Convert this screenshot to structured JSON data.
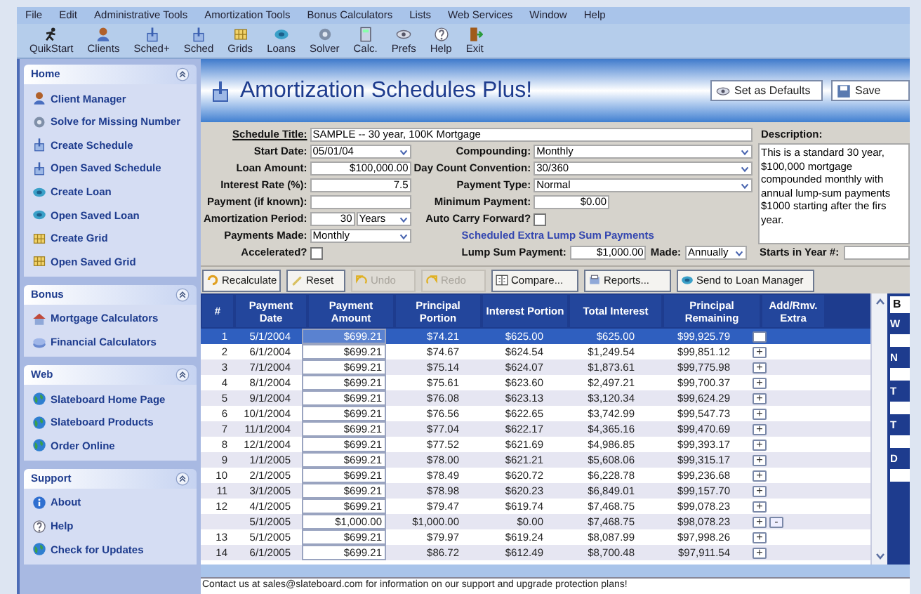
{
  "menu": [
    "File",
    "Edit",
    "Administrative Tools",
    "Amortization Tools",
    "Bonus Calculators",
    "Lists",
    "Web Services",
    "Window",
    "Help"
  ],
  "toolbar": [
    "QuikStart",
    "Clients",
    "Sched+",
    "Sched",
    "Grids",
    "Loans",
    "Solver",
    "Calc.",
    "Prefs",
    "Help",
    "Exit"
  ],
  "sidebar": [
    {
      "title": "Home",
      "items": [
        "Client Manager",
        "Solve for Missing Number",
        "Create Schedule",
        "Open Saved Schedule",
        "Create Loan",
        "Open Saved Loan",
        "Create Grid",
        "Open Saved Grid"
      ]
    },
    {
      "title": "Bonus",
      "items": [
        "Mortgage Calculators",
        "Financial Calculators"
      ]
    },
    {
      "title": "Web",
      "items": [
        "Slateboard Home Page",
        "Slateboard Products",
        "Order Online"
      ]
    },
    {
      "title": "Support",
      "items": [
        "About",
        "Help",
        "Check for Updates"
      ]
    }
  ],
  "header": {
    "title": "Amortization Schedules Plus!",
    "buttons": [
      "Set as Defaults",
      "Save"
    ]
  },
  "form": {
    "title_field": {
      "label": "Schedule Title:",
      "value": "SAMPLE -- 30 year, 100K Mortgage"
    },
    "left": [
      {
        "kind": "dropdown",
        "label": "Start Date:",
        "value": "05/01/04"
      },
      {
        "kind": "text",
        "label": "Loan Amount:",
        "value": "$100,000.00"
      },
      {
        "kind": "text",
        "label": "Interest Rate (%):",
        "value": "7.5"
      },
      {
        "kind": "text",
        "label": "Payment (if known):"
      },
      {
        "kind": "period",
        "label": "Amortization Period:",
        "value": "30",
        "unit": "Years"
      },
      {
        "kind": "dropdown",
        "label": "Payments Made:",
        "value": "Monthly"
      }
    ],
    "middle": [
      {
        "kind": "dropdown",
        "label": "Compounding:",
        "value": "Monthly"
      },
      {
        "kind": "dropdown",
        "label": "Day Count Convention:",
        "value": "30/360"
      },
      {
        "kind": "dropdown",
        "label": "Payment Type:",
        "value": "Normal"
      },
      {
        "kind": "text",
        "label": "Minimum Payment:",
        "value": "$0.00"
      },
      {
        "kind": "checkbox",
        "label": "Auto Carry Forward?",
        "checked": false
      },
      {
        "kind": "heading",
        "label": "Scheduled Extra Lump Sum Payments"
      }
    ],
    "description": {
      "label": "Description:",
      "text": "This is a standard 30 year,\n$100,000 mortgage\ncompounded monthly with\nannual lump-sum payments\n$1000 starting after the firs\nyear."
    },
    "accelerated": {
      "label": "Accelerated?",
      "checked": false
    },
    "lump": {
      "label": "Lump Sum Payment:",
      "value": "$1,000.00",
      "made_label": "Made:",
      "made_value": "Annually",
      "start_label": "Starts in Year #:"
    }
  },
  "action_buttons": [
    {
      "label": "Recalculate",
      "disabled": false
    },
    {
      "label": "Reset",
      "disabled": false
    },
    {
      "label": "Undo",
      "disabled": true
    },
    {
      "label": "Redo",
      "disabled": true
    },
    {
      "label": "Compare...",
      "disabled": false
    },
    {
      "label": "Reports...",
      "disabled": false
    },
    {
      "label": "Send to Loan Manager",
      "disabled": false
    }
  ],
  "table": {
    "columns": [
      "#",
      "Payment Date",
      "Payment Amount",
      "Principal Portion",
      "Interest Portion",
      "Total Interest",
      "Principal Remaining",
      "Add/Rmv. Extra"
    ],
    "rows": [
      {
        "number": "1",
        "date": "5/1/2004",
        "amount": "$699.21",
        "principal": "$74.21",
        "interest": "$625.00",
        "total": "$625.00",
        "remaining": "$99,925.79",
        "selected": true,
        "extras": [
          {
            "kind": "blank"
          }
        ]
      },
      {
        "number": "2",
        "date": "6/1/2004",
        "amount": "$699.21",
        "principal": "$74.67",
        "interest": "$624.54",
        "total": "$1,249.54",
        "remaining": "$99,851.12",
        "selected": false,
        "extras": [
          {
            "kind": "add",
            "label": "+"
          }
        ]
      },
      {
        "number": "3",
        "date": "7/1/2004",
        "amount": "$699.21",
        "principal": "$75.14",
        "interest": "$624.07",
        "total": "$1,873.61",
        "remaining": "$99,775.98",
        "selected": false,
        "extras": [
          {
            "kind": "add",
            "label": "+"
          }
        ]
      },
      {
        "number": "4",
        "date": "8/1/2004",
        "amount": "$699.21",
        "principal": "$75.61",
        "interest": "$623.60",
        "total": "$2,497.21",
        "remaining": "$99,700.37",
        "selected": false,
        "extras": [
          {
            "kind": "add",
            "label": "+"
          }
        ]
      },
      {
        "number": "5",
        "date": "9/1/2004",
        "amount": "$699.21",
        "principal": "$76.08",
        "interest": "$623.13",
        "total": "$3,120.34",
        "remaining": "$99,624.29",
        "selected": false,
        "extras": [
          {
            "kind": "add",
            "label": "+"
          }
        ]
      },
      {
        "number": "6",
        "date": "10/1/2004",
        "amount": "$699.21",
        "principal": "$76.56",
        "interest": "$622.65",
        "total": "$3,742.99",
        "remaining": "$99,547.73",
        "selected": false,
        "extras": [
          {
            "kind": "add",
            "label": "+"
          }
        ]
      },
      {
        "number": "7",
        "date": "11/1/2004",
        "amount": "$699.21",
        "principal": "$77.04",
        "interest": "$622.17",
        "total": "$4,365.16",
        "remaining": "$99,470.69",
        "selected": false,
        "extras": [
          {
            "kind": "add",
            "label": "+"
          }
        ]
      },
      {
        "number": "8",
        "date": "12/1/2004",
        "amount": "$699.21",
        "principal": "$77.52",
        "interest": "$621.69",
        "total": "$4,986.85",
        "remaining": "$99,393.17",
        "selected": false,
        "extras": [
          {
            "kind": "add",
            "label": "+"
          }
        ]
      },
      {
        "number": "9",
        "date": "1/1/2005",
        "amount": "$699.21",
        "principal": "$78.00",
        "interest": "$621.21",
        "total": "$5,608.06",
        "remaining": "$99,315.17",
        "selected": false,
        "extras": [
          {
            "kind": "add",
            "label": "+"
          }
        ]
      },
      {
        "number": "10",
        "date": "2/1/2005",
        "amount": "$699.21",
        "principal": "$78.49",
        "interest": "$620.72",
        "total": "$6,228.78",
        "remaining": "$99,236.68",
        "selected": false,
        "extras": [
          {
            "kind": "add",
            "label": "+"
          }
        ]
      },
      {
        "number": "11",
        "date": "3/1/2005",
        "amount": "$699.21",
        "principal": "$78.98",
        "interest": "$620.23",
        "total": "$6,849.01",
        "remaining": "$99,157.70",
        "selected": false,
        "extras": [
          {
            "kind": "add",
            "label": "+"
          }
        ]
      },
      {
        "number": "12",
        "date": "4/1/2005",
        "amount": "$699.21",
        "principal": "$79.47",
        "interest": "$619.74",
        "total": "$7,468.75",
        "remaining": "$99,078.23",
        "selected": false,
        "extras": [
          {
            "kind": "add",
            "label": "+"
          }
        ]
      },
      {
        "date": "5/1/2005",
        "amount": "$1,000.00",
        "principal": "$1,000.00",
        "interest": "$0.00",
        "total": "$7,468.75",
        "remaining": "$98,078.23",
        "selected": false,
        "extras": [
          {
            "kind": "add",
            "label": "+"
          },
          {
            "kind": "remove",
            "label": "-"
          }
        ]
      },
      {
        "number": "13",
        "date": "5/1/2005",
        "amount": "$699.21",
        "principal": "$79.97",
        "interest": "$619.24",
        "total": "$8,087.99",
        "remaining": "$97,998.26",
        "selected": false,
        "extras": [
          {
            "kind": "add",
            "label": "+"
          }
        ]
      },
      {
        "number": "14",
        "date": "6/1/2005",
        "amount": "$699.21",
        "principal": "$86.72",
        "interest": "$612.49",
        "total": "$8,700.48",
        "remaining": "$97,911.54",
        "selected": false,
        "extras": [
          {
            "kind": "add",
            "label": "+"
          }
        ]
      }
    ]
  },
  "side_panel": {
    "button": "B",
    "labels": [
      "W",
      "N",
      "T",
      "T",
      "D"
    ]
  },
  "footer": "Contact us at sales@slateboard.com for information on our support and upgrade protection plans!"
}
